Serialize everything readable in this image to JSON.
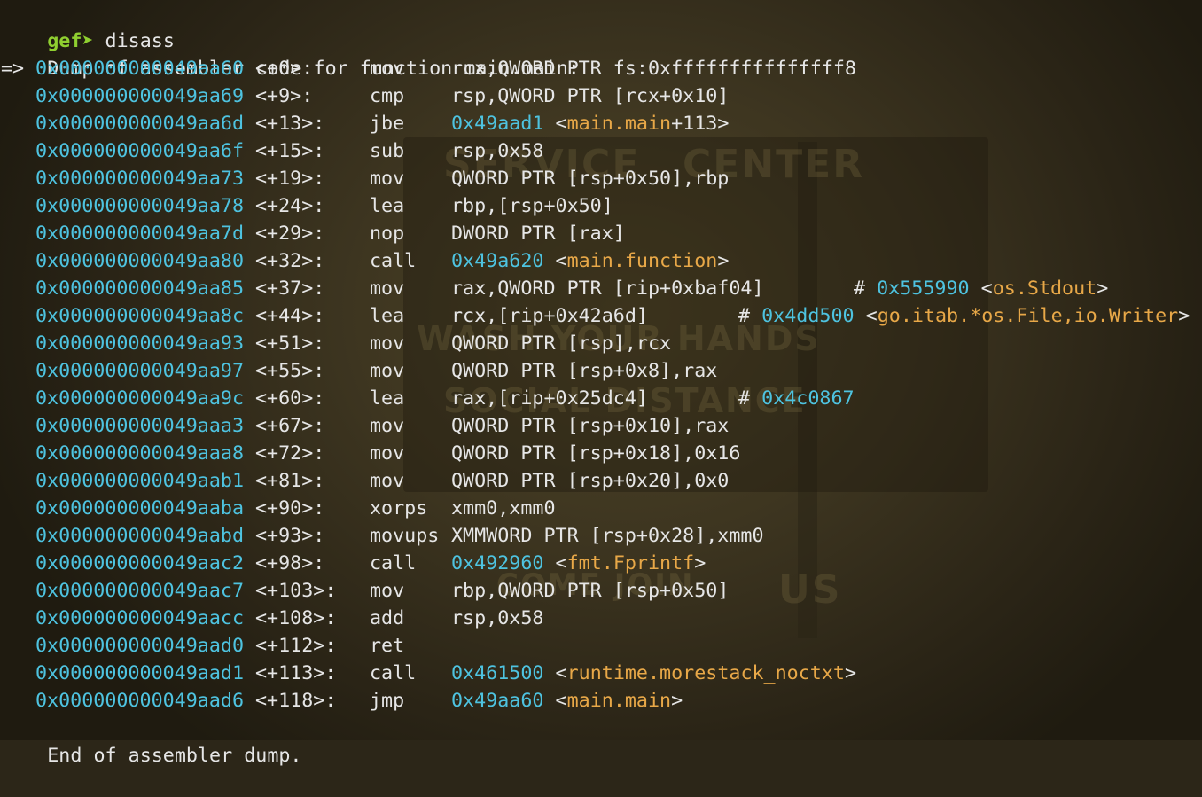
{
  "prompt": {
    "name": "gef",
    "arrow": "➤",
    "command": "disass"
  },
  "header_line": "Dump of assembler code for function main.main:",
  "current_marker": "=>",
  "footer_line": "End of assembler dump.",
  "background_sign_words": [
    "SERVICE",
    "CENTER",
    "WASH YOUR HANDS",
    "SOCIAL DISTANCE",
    "COME JOIN",
    "US"
  ],
  "colors": {
    "address": "#4ec3e0",
    "symbol": "#e8a848",
    "prompt": "#8fcf30",
    "text": "#e6e6e6"
  },
  "instructions": [
    {
      "addr": "0x000000000049aa60",
      "offset": "<+0>:",
      "mnemonic": "mov",
      "operands": "rcx,QWORD PTR fs:0xfffffffffffffff8"
    },
    {
      "addr": "0x000000000049aa69",
      "offset": "<+9>:",
      "mnemonic": "cmp",
      "operands": "rsp,QWORD PTR [rcx+0x10]"
    },
    {
      "addr": "0x000000000049aa6d",
      "offset": "<+13>:",
      "mnemonic": "jbe",
      "operands": "",
      "target": "0x49aad1",
      "sym_open": "<",
      "sym": "main.main",
      "sym_tail": "+113>"
    },
    {
      "addr": "0x000000000049aa6f",
      "offset": "<+15>:",
      "mnemonic": "sub",
      "operands": "rsp,0x58"
    },
    {
      "addr": "0x000000000049aa73",
      "offset": "<+19>:",
      "mnemonic": "mov",
      "operands": "QWORD PTR [rsp+0x50],rbp"
    },
    {
      "addr": "0x000000000049aa78",
      "offset": "<+24>:",
      "mnemonic": "lea",
      "operands": "rbp,[rsp+0x50]"
    },
    {
      "addr": "0x000000000049aa7d",
      "offset": "<+29>:",
      "mnemonic": "nop",
      "operands": "DWORD PTR [rax]"
    },
    {
      "addr": "0x000000000049aa80",
      "offset": "<+32>:",
      "mnemonic": "call",
      "operands": "",
      "target": "0x49a620",
      "sym_open": "<",
      "sym": "main.function",
      "sym_tail": ">"
    },
    {
      "addr": "0x000000000049aa85",
      "offset": "<+37>:",
      "mnemonic": "mov",
      "operands": "rax,QWORD PTR [rip+0xbaf04]",
      "comment_mark": "#",
      "comment_addr": "0x555990",
      "comment_open": "<",
      "comment_sym": "os.Stdout",
      "comment_tail": ">"
    },
    {
      "addr": "0x000000000049aa8c",
      "offset": "<+44>:",
      "mnemonic": "lea",
      "operands": "rcx,[rip+0x42a6d]",
      "comment_mark": "#",
      "comment_addr": "0x4dd500",
      "comment_open": "<",
      "comment_sym": "go.itab.*os.File,io.Writer",
      "comment_tail": ">"
    },
    {
      "addr": "0x000000000049aa93",
      "offset": "<+51>:",
      "mnemonic": "mov",
      "operands": "QWORD PTR [rsp],rcx"
    },
    {
      "addr": "0x000000000049aa97",
      "offset": "<+55>:",
      "mnemonic": "mov",
      "operands": "QWORD PTR [rsp+0x8],rax"
    },
    {
      "addr": "0x000000000049aa9c",
      "offset": "<+60>:",
      "mnemonic": "lea",
      "operands": "rax,[rip+0x25dc4]",
      "comment_mark": "#",
      "comment_addr": "0x4c0867"
    },
    {
      "addr": "0x000000000049aaa3",
      "offset": "<+67>:",
      "mnemonic": "mov",
      "operands": "QWORD PTR [rsp+0x10],rax"
    },
    {
      "addr": "0x000000000049aaa8",
      "offset": "<+72>:",
      "mnemonic": "mov",
      "operands": "QWORD PTR [rsp+0x18],0x16"
    },
    {
      "addr": "0x000000000049aab1",
      "offset": "<+81>:",
      "mnemonic": "mov",
      "operands": "QWORD PTR [rsp+0x20],0x0"
    },
    {
      "addr": "0x000000000049aaba",
      "offset": "<+90>:",
      "mnemonic": "xorps",
      "operands": "xmm0,xmm0"
    },
    {
      "addr": "0x000000000049aabd",
      "offset": "<+93>:",
      "mnemonic": "movups",
      "operands": "XMMWORD PTR [rsp+0x28],xmm0"
    },
    {
      "addr": "0x000000000049aac2",
      "offset": "<+98>:",
      "mnemonic": "call",
      "operands": "",
      "target": "0x492960",
      "sym_open": "<",
      "sym": "fmt.Fprintf",
      "sym_tail": ">"
    },
    {
      "addr": "0x000000000049aac7",
      "offset": "<+103>:",
      "mnemonic": "mov",
      "operands": "rbp,QWORD PTR [rsp+0x50]"
    },
    {
      "addr": "0x000000000049aacc",
      "offset": "<+108>:",
      "mnemonic": "add",
      "operands": "rsp,0x58"
    },
    {
      "addr": "0x000000000049aad0",
      "offset": "<+112>:",
      "mnemonic": "ret",
      "operands": ""
    },
    {
      "addr": "0x000000000049aad1",
      "offset": "<+113>:",
      "mnemonic": "call",
      "operands": "",
      "target": "0x461500",
      "sym_open": "<",
      "sym": "runtime.morestack_noctxt",
      "sym_tail": ">"
    },
    {
      "addr": "0x000000000049aad6",
      "offset": "<+118>:",
      "mnemonic": "jmp",
      "operands": "",
      "target": "0x49aa60",
      "sym_open": "<",
      "sym": "main.main",
      "sym_tail": ">"
    }
  ]
}
